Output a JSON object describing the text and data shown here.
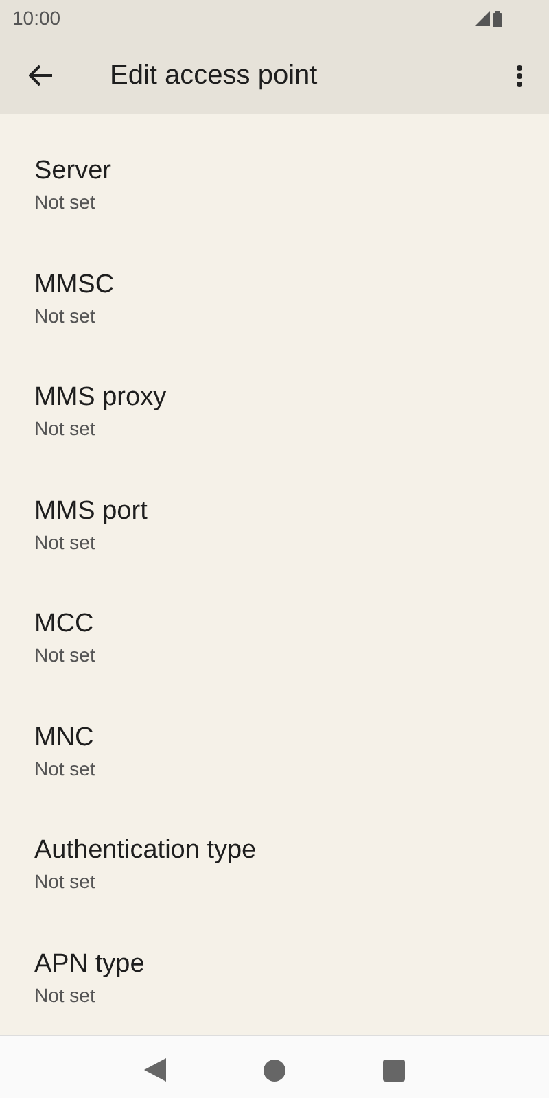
{
  "status_bar": {
    "time": "10:00"
  },
  "app_bar": {
    "title": "Edit access point"
  },
  "settings": [
    {
      "title": "Server",
      "value": "Not set"
    },
    {
      "title": "MMSC",
      "value": "Not set"
    },
    {
      "title": "MMS proxy",
      "value": "Not set"
    },
    {
      "title": "MMS port",
      "value": "Not set"
    },
    {
      "title": "MCC",
      "value": "Not set"
    },
    {
      "title": "MNC",
      "value": "Not set"
    },
    {
      "title": "Authentication type",
      "value": "Not set"
    },
    {
      "title": "APN type",
      "value": "Not set"
    }
  ]
}
